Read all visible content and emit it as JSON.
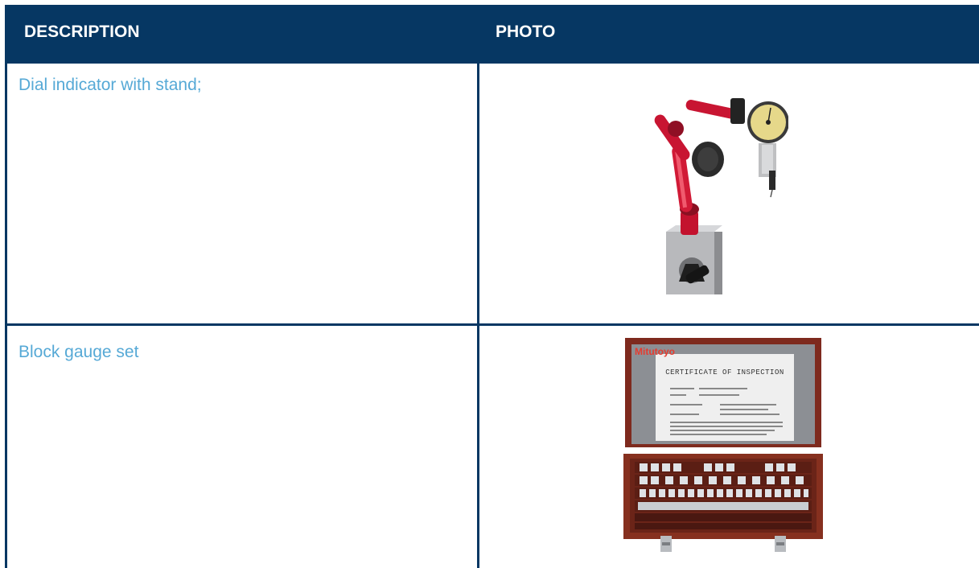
{
  "table": {
    "headers": {
      "description": "DESCRIPTION",
      "photo": "PHOTO"
    },
    "rows": [
      {
        "description": "Dial indicator with stand;",
        "photo": "dial-indicator-with-magnetic-stand"
      },
      {
        "description": "Block gauge set",
        "photo": "gauge-block-set-case"
      }
    ]
  },
  "images": {
    "gauge_case": {
      "brand": "Mitutoyo",
      "certificate_title": "CERTIFICATE OF INSPECTION"
    }
  },
  "colors": {
    "header_bg": "#063763",
    "header_text": "#ffffff",
    "cell_text": "#56a9d6",
    "border": "#063763"
  }
}
